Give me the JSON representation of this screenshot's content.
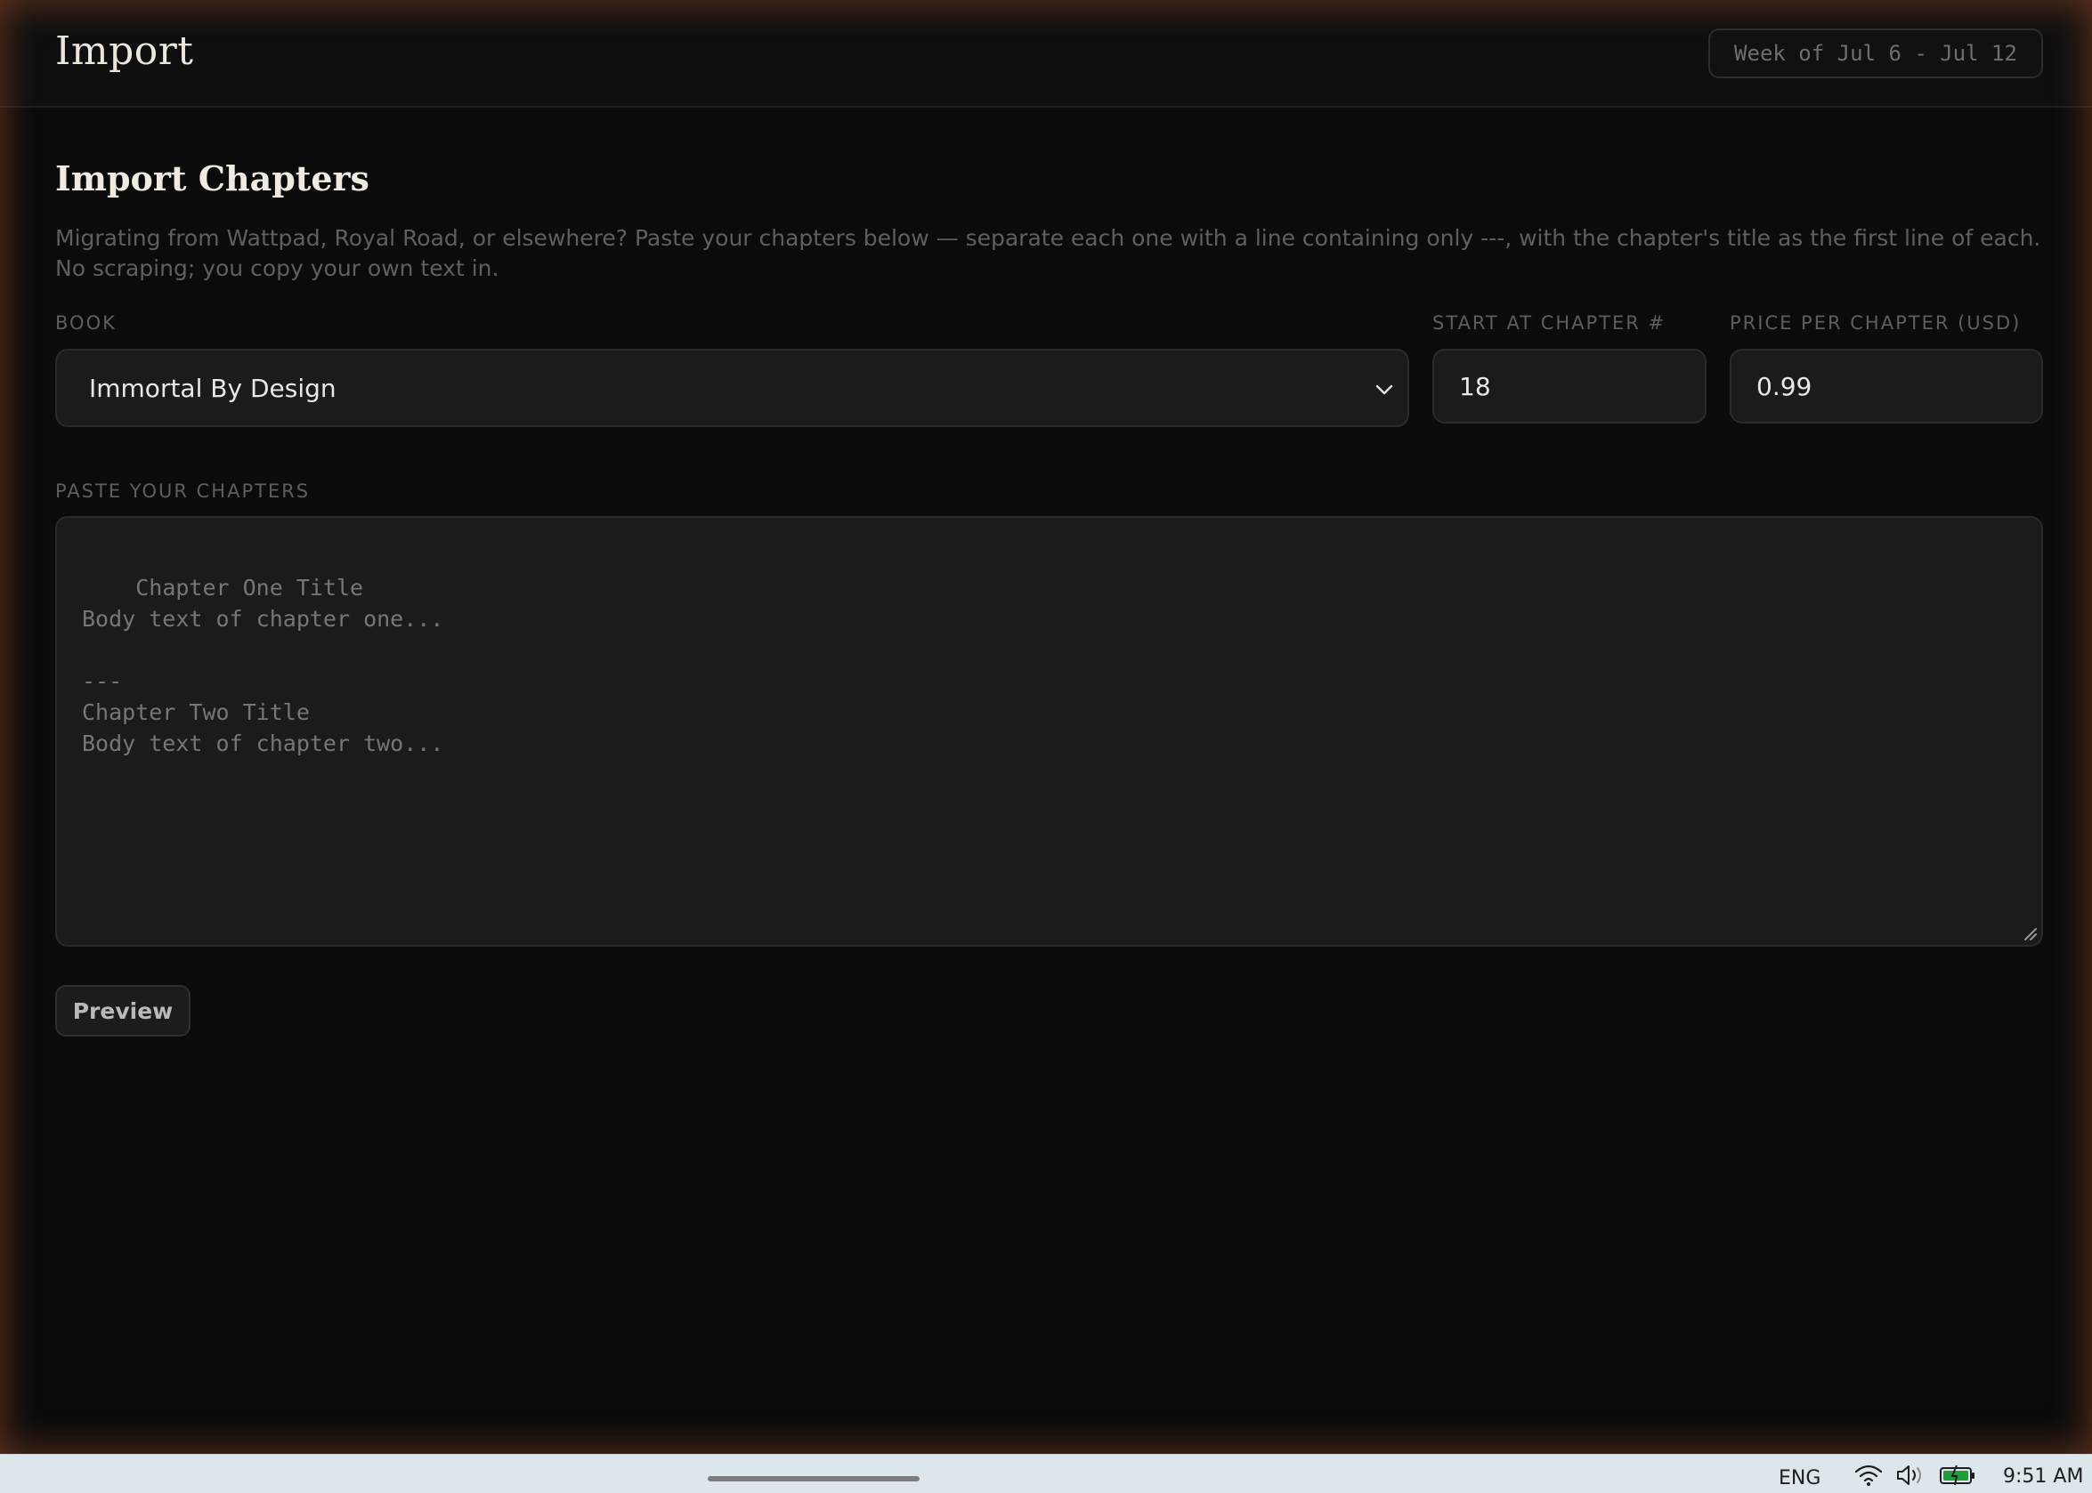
{
  "header": {
    "title": "Import",
    "week_label": "Week of Jul 6 - Jul 12"
  },
  "main": {
    "section_title": "Import Chapters",
    "description": "Migrating from Wattpad, Royal Road, or elsewhere? Paste your chapters below — separate each one with a line containing only ---, with the chapter's title as the first line of each. No scraping; you copy your own text in.",
    "book": {
      "label": "BOOK",
      "selected": "Immortal By Design"
    },
    "start_chapter": {
      "label": "START AT CHAPTER #",
      "value": "18"
    },
    "price": {
      "label": "PRICE PER CHAPTER (USD)",
      "value": "0.99"
    },
    "chapters": {
      "label": "PASTE YOUR CHAPTERS",
      "placeholder": "Chapter One Title\nBody text of chapter one...\n\n---\nChapter Two Title\nBody text of chapter two..."
    },
    "preview_label": "Preview"
  },
  "taskbar": {
    "language": "ENG",
    "time": "9:51 AM",
    "icons": [
      "wifi-icon",
      "volume-icon",
      "battery-icon"
    ]
  },
  "colors": {
    "background": "#0b0b0b",
    "field": "#1b1b1b",
    "accent_glow": "#964828",
    "battery": "#1f9d3a"
  }
}
